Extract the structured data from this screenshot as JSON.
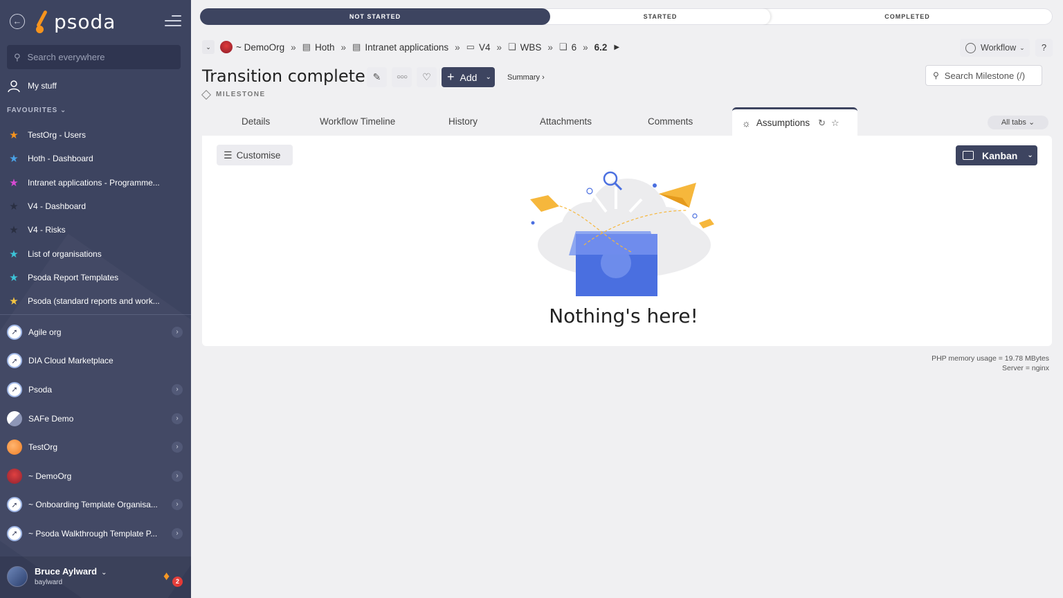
{
  "sidebar": {
    "logo_text": "psoda",
    "search_placeholder": "Search everywhere",
    "my_stuff": "My stuff",
    "favourites_heading": "FAVOURITES",
    "favourites": [
      {
        "label": "TestOrg - Users",
        "color": "#f7941d"
      },
      {
        "label": "Hoth - Dashboard",
        "color": "#4aa3e8"
      },
      {
        "label": "Intranet applications - Programme...",
        "color": "#d94bd4"
      },
      {
        "label": "V4 - Dashboard",
        "color": "#2a2f42"
      },
      {
        "label": "V4 - Risks",
        "color": "#2a2f42"
      },
      {
        "label": "List of organisations",
        "color": "#3cc4d8"
      },
      {
        "label": "Psoda Report Templates",
        "color": "#3cc4d8"
      },
      {
        "label": "Psoda (standard reports and work...",
        "color": "#f4c542"
      }
    ],
    "organisations": [
      {
        "label": "Agile org",
        "chevron": true
      },
      {
        "label": "DIA Cloud Marketplace",
        "chevron": false
      },
      {
        "label": "Psoda",
        "chevron": true
      },
      {
        "label": "SAFe Demo",
        "chevron": true
      },
      {
        "label": "TestOrg",
        "chevron": true
      },
      {
        "label": "~ DemoOrg",
        "chevron": true
      },
      {
        "label": "~ Onboarding Template Organisa...",
        "chevron": true
      },
      {
        "label": "~ Psoda Walkthrough Template P...",
        "chevron": true
      }
    ],
    "user": {
      "name": "Bruce Aylward",
      "login": "baylward",
      "notifications": "2"
    }
  },
  "progress": {
    "steps": [
      "NOT STARTED",
      "STARTED",
      "COMPLETED"
    ]
  },
  "breadcrumb": {
    "items": [
      "~ DemoOrg",
      "Hoth",
      "Intranet applications",
      "V4",
      "WBS",
      "6",
      "6.2"
    ]
  },
  "header": {
    "title": "Transition complete",
    "type": "MILESTONE",
    "add_label": "Add",
    "summary_link": "Summary ›",
    "workflow_label": "Workflow",
    "help_label": "?",
    "search_placeholder": "Search Milestone (/)"
  },
  "tabs": {
    "items": [
      "Details",
      "Workflow Timeline",
      "History",
      "Attachments",
      "Comments"
    ],
    "active": "Assumptions",
    "all_tabs": "All tabs"
  },
  "content": {
    "customise_label": "Customise",
    "view_label": "Kanban",
    "empty_message": "Nothing's here!"
  },
  "footer": {
    "memory": "PHP memory usage = 19.78 MBytes",
    "server": "Server = nginx"
  }
}
